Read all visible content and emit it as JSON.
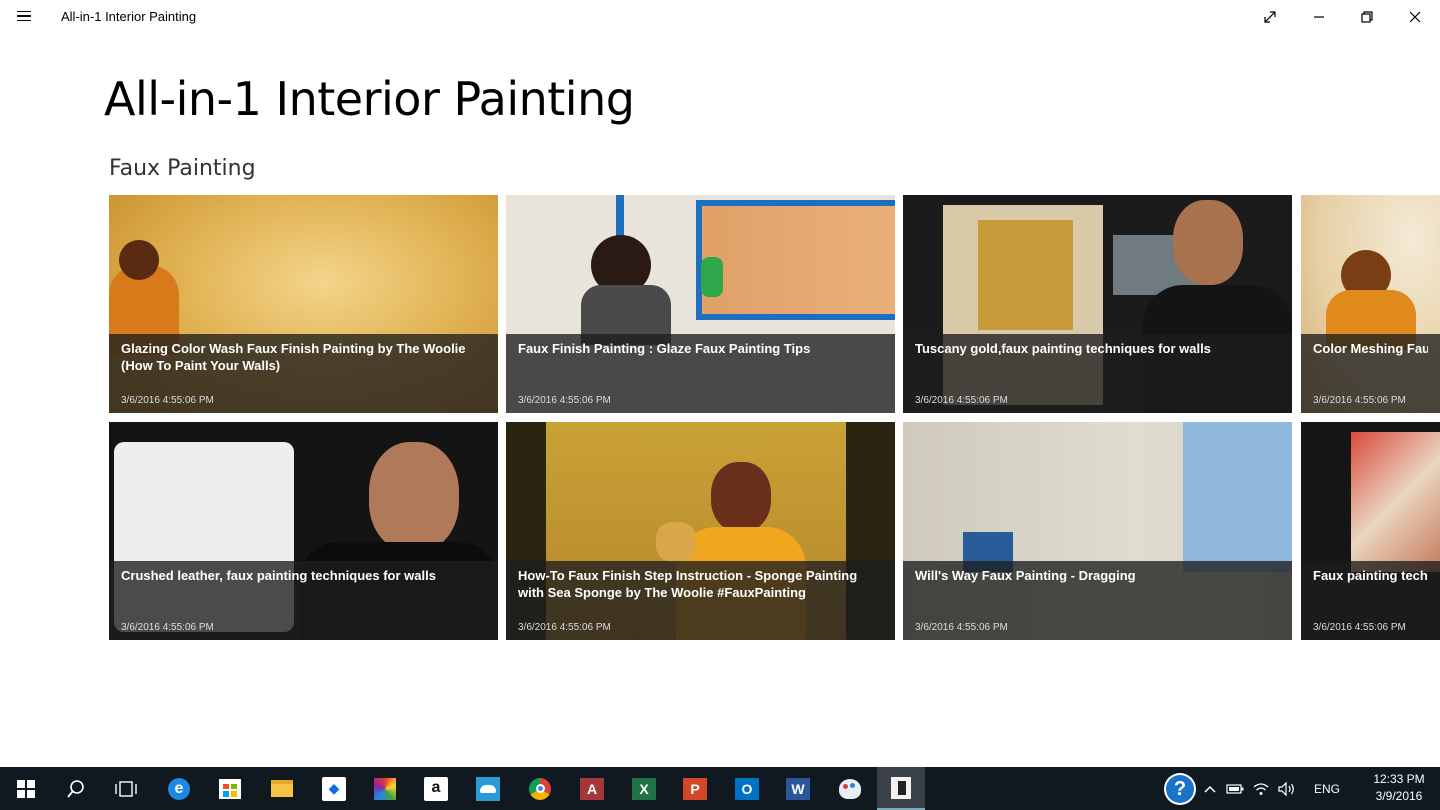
{
  "window": {
    "app_title": "All-in-1 Interior Painting"
  },
  "page": {
    "heading": "All-in-1 Interior Painting",
    "section_title": "Faux Painting"
  },
  "videos": [
    {
      "title": "Glazing Color Wash Faux Finish Painting by The Woolie (How To Paint Your Walls)",
      "date": "3/6/2016 4:55:06 PM"
    },
    {
      "title": "Faux Finish Painting : Glaze Faux Painting Tips",
      "date": "3/6/2016 4:55:06 PM"
    },
    {
      "title": "Tuscany gold,faux painting techniques for walls",
      "date": "3/6/2016 4:55:06 PM"
    },
    {
      "title": "Color Meshing Faux F Fastest & Easiest Finis",
      "date": "3/6/2016 4:55:06 PM"
    },
    {
      "title": "Crushed leather, faux painting techniques for walls",
      "date": "3/6/2016 4:55:06 PM"
    },
    {
      "title": "How-To Faux Finish Step Instruction - Sponge Painting with Sea Sponge by The Woolie #FauxPainting",
      "date": "3/6/2016 4:55:06 PM"
    },
    {
      "title": "Will's Way Faux Painting - Dragging",
      "date": "3/6/2016 4:55:06 PM"
    },
    {
      "title": "Faux painting techniq textured finish with g",
      "date": "3/6/2016 4:55:06 PM"
    }
  ],
  "taskbar": {
    "apps": [
      "start-icon",
      "search-icon",
      "task-view-icon",
      "edge-icon",
      "store-icon",
      "file-explorer-icon",
      "dropbox-icon",
      "photo-app-icon",
      "amazon-icon",
      "onedrive-icon",
      "chrome-icon",
      "access-icon",
      "excel-icon",
      "powerpoint-icon",
      "outlook-icon",
      "word-icon",
      "paint-icon",
      "interior-painting-app-icon"
    ],
    "language": "ENG",
    "time": "12:33 PM",
    "date": "3/9/2016"
  },
  "colors": {
    "taskbar_bg": "#101820",
    "overlay_bg": "#1e1e1e"
  }
}
